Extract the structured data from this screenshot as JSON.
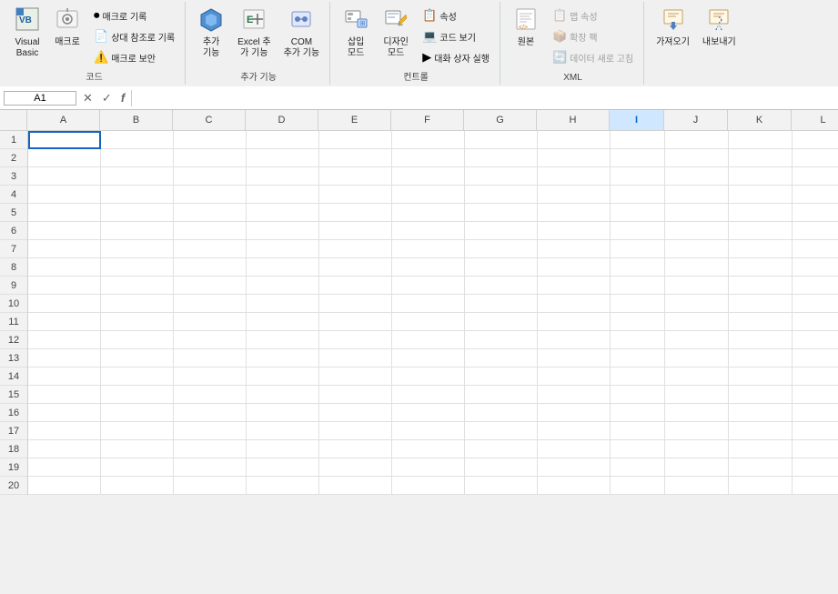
{
  "ribbon": {
    "groups": [
      {
        "name": "코드",
        "label": "코드",
        "buttons": [
          {
            "id": "visual-basic",
            "icon": "📋",
            "label": "Visual\nBasic",
            "size": "large"
          },
          {
            "id": "macro",
            "icon": "⚙️",
            "label": "매크로",
            "size": "large"
          }
        ],
        "small_buttons": [
          {
            "id": "record-macro",
            "icon": "⏺",
            "label": "매크로 기록"
          },
          {
            "id": "relative-ref",
            "icon": "📄",
            "label": "상대 참조로 기록"
          },
          {
            "id": "macro-security",
            "icon": "⚠️",
            "label": "매크로 보안"
          }
        ]
      },
      {
        "name": "추가 기능",
        "label": "추가 기능",
        "buttons": [
          {
            "id": "add-feature",
            "icon": "⬡",
            "label": "추가\n기능",
            "size": "large"
          },
          {
            "id": "excel-add",
            "icon": "🔧",
            "label": "Excel 추\n가 기능",
            "size": "large"
          },
          {
            "id": "com-add",
            "icon": "🔩",
            "label": "COM\n추가 기능",
            "size": "large"
          }
        ]
      },
      {
        "name": "컨트롤",
        "label": "컨트롤",
        "buttons": [
          {
            "id": "insert-ctrl",
            "icon": "📥",
            "label": "삽입\n모드",
            "size": "large"
          },
          {
            "id": "design-mode",
            "icon": "✏️",
            "label": "디자인\n모드",
            "size": "large"
          }
        ],
        "small_buttons": [
          {
            "id": "properties",
            "icon": "📋",
            "label": "속성"
          },
          {
            "id": "view-code",
            "icon": "💻",
            "label": "코드 보기"
          },
          {
            "id": "dialog-run",
            "icon": "▶️",
            "label": "대화 상자 실행"
          }
        ]
      },
      {
        "name": "XML",
        "label": "XML",
        "buttons": [
          {
            "id": "source",
            "icon": "📄",
            "label": "원본",
            "size": "large"
          }
        ],
        "small_buttons": [
          {
            "id": "map-props",
            "icon": "📋",
            "label": "맵 속성"
          },
          {
            "id": "expand-pack",
            "icon": "📦",
            "label": "확장 팩"
          },
          {
            "id": "refresh-data",
            "icon": "🔄",
            "label": "데이터 새로 고침"
          }
        ]
      },
      {
        "name": "가져오기",
        "label": "",
        "buttons": [
          {
            "id": "import",
            "icon": "📂",
            "label": "가져오기",
            "size": "large",
            "disabled": false
          },
          {
            "id": "export",
            "icon": "📤",
            "label": "내보내기",
            "size": "large",
            "disabled": false
          }
        ]
      }
    ]
  },
  "formula_bar": {
    "name_box": "A1",
    "cancel_label": "✕",
    "confirm_label": "✓",
    "function_label": "f",
    "formula_value": ""
  },
  "spreadsheet": {
    "columns": [
      "A",
      "B",
      "C",
      "D",
      "E",
      "F",
      "G",
      "H",
      "I",
      "J",
      "K",
      "L"
    ],
    "selected_col": "I",
    "selected_cell": "A1",
    "row_count": 20,
    "rows": [
      1,
      2,
      3,
      4,
      5,
      6,
      7,
      8,
      9,
      10,
      11,
      12,
      13,
      14,
      15,
      16,
      17,
      18,
      19,
      20
    ]
  }
}
